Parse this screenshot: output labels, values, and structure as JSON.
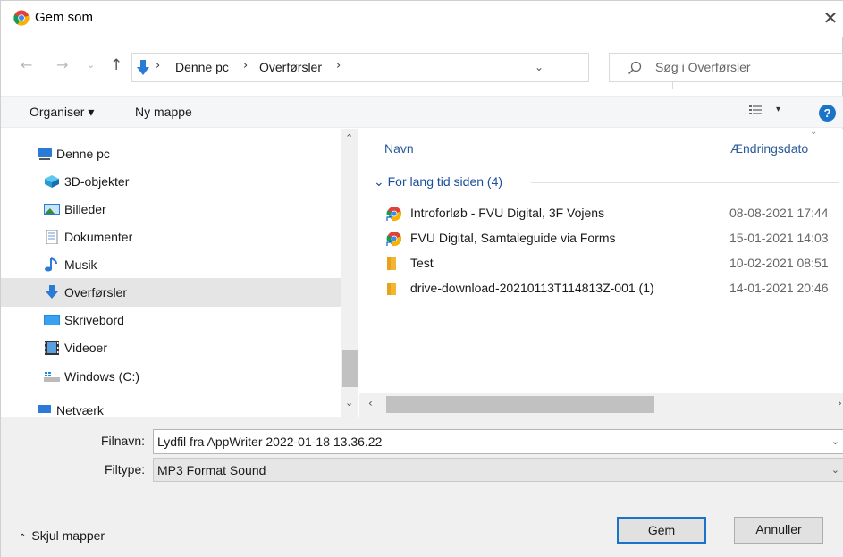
{
  "window": {
    "title": "Gem som",
    "close_glyph": "✕"
  },
  "address": {
    "back_glyph": "←",
    "forward_glyph": "→",
    "recent_glyph": "⌄",
    "up_glyph": "↑",
    "sep_glyph": "›",
    "crumbs": [
      "Denne pc",
      "Overførsler"
    ],
    "dropdown_glyph": "⌄",
    "refresh_glyph": "↻"
  },
  "search": {
    "placeholder": "Søg i Overførsler"
  },
  "toolbar": {
    "organise_label": "Organiser ▾",
    "new_folder_label": "Ny mappe",
    "view_dd_glyph": "▾",
    "help_glyph": "?"
  },
  "nav": {
    "items": [
      {
        "label": "Denne pc",
        "icon": "computer-icon"
      },
      {
        "label": "3D-objekter",
        "icon": "3d-objects-icon"
      },
      {
        "label": "Billeder",
        "icon": "pictures-icon"
      },
      {
        "label": "Dokumenter",
        "icon": "documents-icon"
      },
      {
        "label": "Musik",
        "icon": "music-icon"
      },
      {
        "label": "Overførsler",
        "icon": "downloads-icon",
        "selected": true
      },
      {
        "label": "Skrivebord",
        "icon": "desktop-icon"
      },
      {
        "label": "Videoer",
        "icon": "videos-icon"
      },
      {
        "label": "Windows (C:)",
        "icon": "drive-icon"
      },
      {
        "label": "Netværk",
        "icon": "network-icon"
      }
    ],
    "scroll_up": "⌃",
    "scroll_down": "⌄"
  },
  "files": {
    "columns": {
      "name": "Navn",
      "date": "Ændringsdato"
    },
    "sort_glyph": "⌄",
    "group_label": "⌄  For lang tid siden (4)",
    "rows": [
      {
        "name": "Introforløb - FVU Digital, 3F Vojens",
        "date": "08-08-2021 17:44",
        "icon": "chrome-shortcut-icon"
      },
      {
        "name": "FVU Digital, Samtaleguide via Forms",
        "date": "15-01-2021 14:03",
        "icon": "chrome-shortcut-icon"
      },
      {
        "name": "Test",
        "date": "10-02-2021 08:51",
        "icon": "folder-icon"
      },
      {
        "name": "drive-download-20210113T114813Z-001 (1)",
        "date": "14-01-2021 20:46",
        "icon": "folder-icon"
      }
    ],
    "hscroll_left": "‹",
    "hscroll_right": "›"
  },
  "form": {
    "filename_label": "Filnavn:",
    "filename_value": "Lydfil fra AppWriter 2022-01-18 13.36.22",
    "filetype_label": "Filtype:",
    "filetype_value": "MP3 Format Sound",
    "dropdown_glyph": "⌄"
  },
  "footer": {
    "hide_folders_chevron": "⌃",
    "hide_folders_label": "Skjul mapper",
    "save_label": "Gem",
    "cancel_label": "Annuller"
  },
  "colors": {
    "accent": "#1a73c9",
    "selection": "#e5e5e5",
    "link": "#1a4f9c"
  }
}
